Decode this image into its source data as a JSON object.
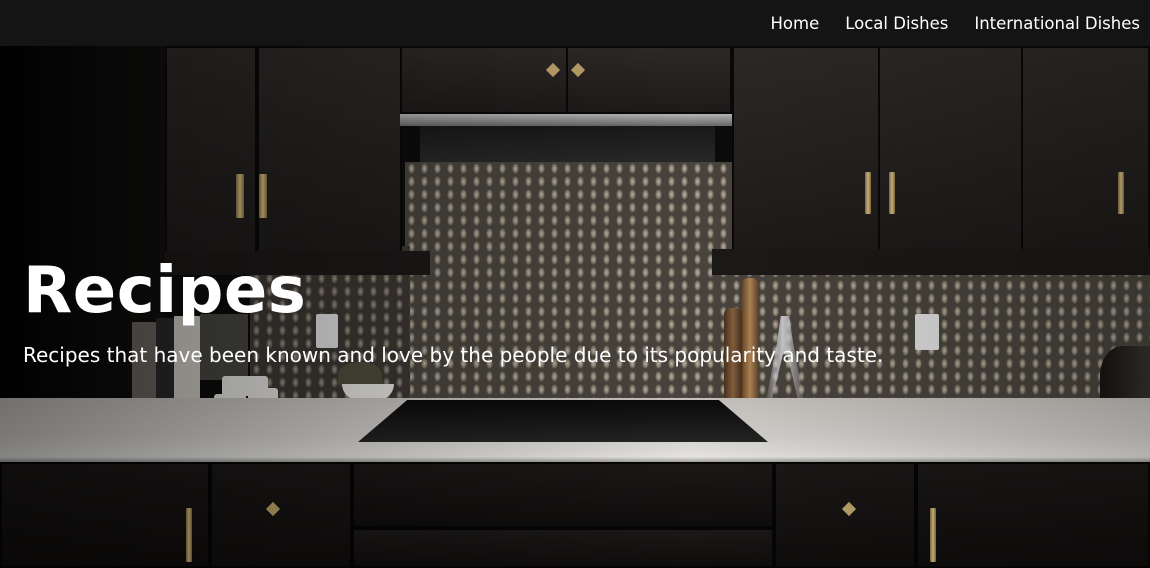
{
  "nav": {
    "links": [
      {
        "label": "Home"
      },
      {
        "label": "Local Dishes"
      },
      {
        "label": "International Dishes"
      }
    ]
  },
  "hero": {
    "title": "Recipes",
    "subtitle": "Recipes that have been known and love by the people due to its popularity and taste."
  },
  "colors": {
    "nav_background": "#141414",
    "text": "#ffffff",
    "hardware_gold": "#c8ad70"
  }
}
